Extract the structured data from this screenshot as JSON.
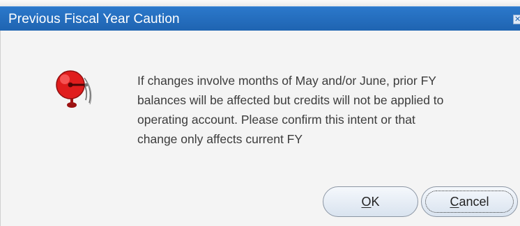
{
  "dialog": {
    "title": "Previous Fiscal Year Caution",
    "close_glyph": "✕",
    "icon": "alarm-bell-icon",
    "message": "If changes involve months of May and/or June, prior FY\nbalances will be affected but credits will not be applied to\noperating account. Please confirm this intent or that\nchange only affects current FY",
    "buttons": {
      "ok": {
        "mnemonic": "O",
        "rest": "K"
      },
      "cancel": {
        "mnemonic": "C",
        "rest": "ancel"
      }
    }
  },
  "colors": {
    "titlebar": "#1f64b1",
    "body": "#f4f4f4",
    "alarm_red": "#e01d1d"
  }
}
